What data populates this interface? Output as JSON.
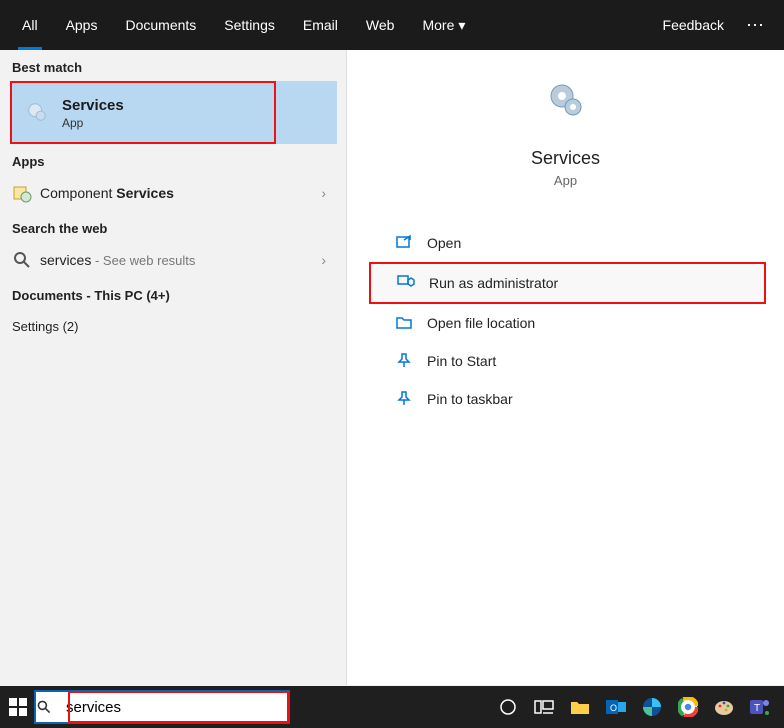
{
  "tabs": {
    "all": "All",
    "apps": "Apps",
    "documents": "Documents",
    "settings": "Settings",
    "email": "Email",
    "web": "Web",
    "more": "More",
    "feedback": "Feedback"
  },
  "sections": {
    "best_match": "Best match",
    "apps": "Apps",
    "search_web": "Search the web",
    "documents": "Documents - This PC (4+)",
    "settings": "Settings (2)"
  },
  "best_match": {
    "title": "Services",
    "subtitle": "App"
  },
  "apps_list": {
    "component_prefix": "Component ",
    "component_bold": "Services"
  },
  "web": {
    "query": "services",
    "suffix": " - See web results"
  },
  "detail": {
    "title": "Services",
    "subtitle": "App",
    "actions": {
      "open": "Open",
      "run_admin": "Run as administrator",
      "open_loc": "Open file location",
      "pin_start": "Pin to Start",
      "pin_taskbar": "Pin to taskbar"
    }
  },
  "search": {
    "value": "services"
  }
}
